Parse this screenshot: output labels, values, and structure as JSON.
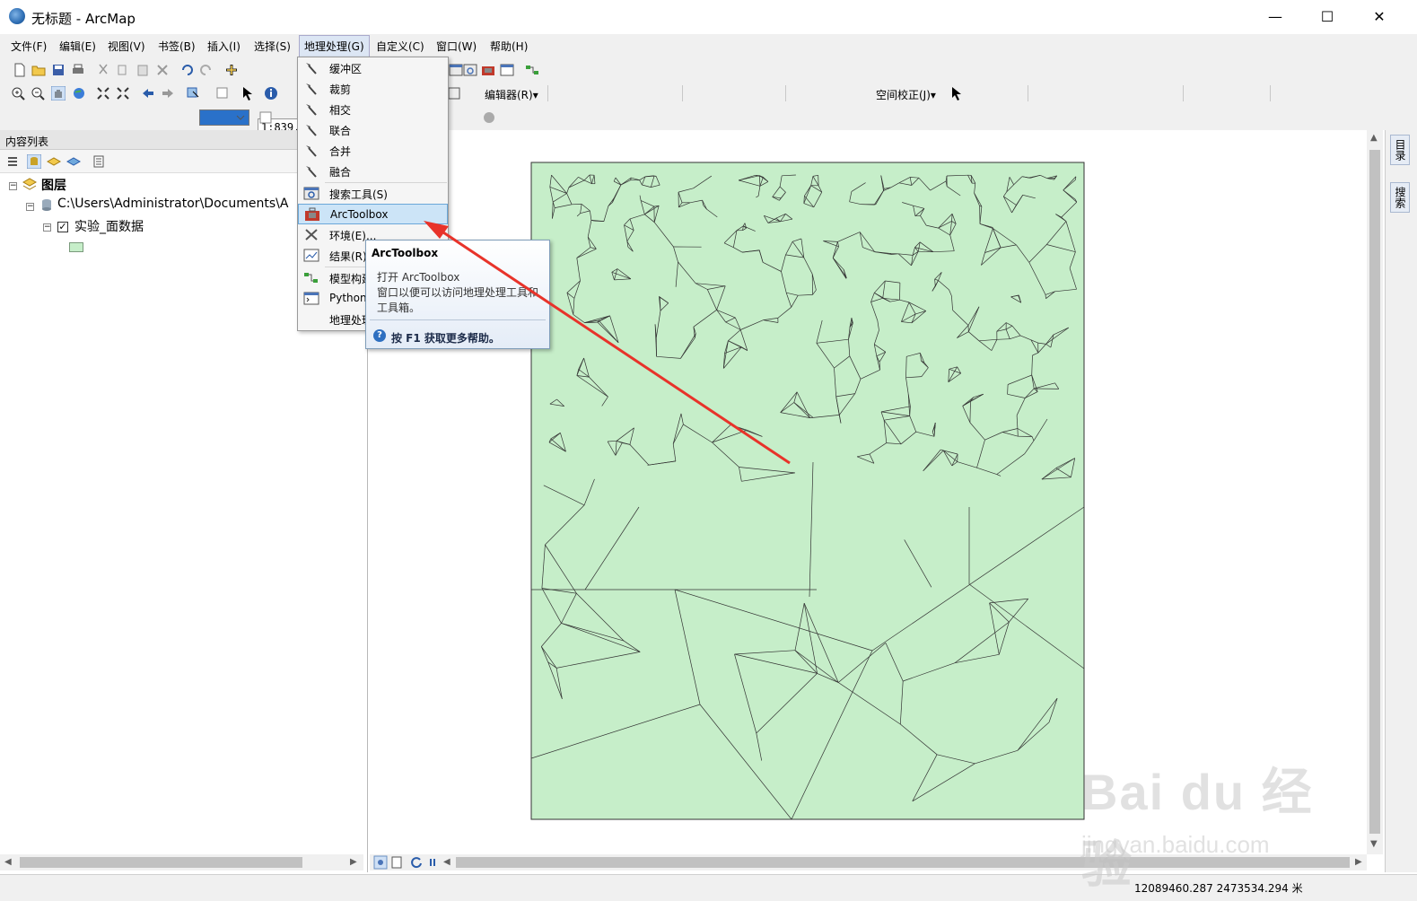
{
  "window": {
    "title": "无标题 - ArcMap",
    "minimize": "—",
    "maximize": "☐",
    "close": "✕"
  },
  "menubar": {
    "items": [
      "文件(F)",
      "编辑(E)",
      "视图(V)",
      "书签(B)",
      "插入(I)",
      "选择(S)",
      "地理处理(G)",
      "自定义(C)",
      "窗口(W)",
      "帮助(H)"
    ],
    "active_index": 6
  },
  "toolbar": {
    "scale_value": "1:839,",
    "editor_label": "编辑器(R)▾",
    "spatial_adjust_label": "空间校正(J)▾"
  },
  "toc": {
    "header": "内容列表",
    "layers_root": "图层",
    "data_path": "C:\\Users\\Administrator\\Documents\\A",
    "layer_name": "实验_面数据",
    "layer_color": "#c6eec9"
  },
  "geoprocessing_menu": {
    "items": [
      {
        "label": "缓冲区",
        "icon": "hammer-icon"
      },
      {
        "label": "裁剪",
        "icon": "hammer-icon"
      },
      {
        "label": "相交",
        "icon": "hammer-icon"
      },
      {
        "label": "联合",
        "icon": "hammer-icon"
      },
      {
        "label": "合并",
        "icon": "hammer-icon"
      },
      {
        "label": "融合",
        "icon": "hammer-icon"
      },
      {
        "label": "搜索工具(S)",
        "icon": "search-window-icon"
      },
      {
        "label": "ArcToolbox",
        "icon": "toolbox-icon"
      },
      {
        "label": "环境(E)...",
        "icon": "tools-icon"
      },
      {
        "label": "结果(R)",
        "icon": "results-icon"
      },
      {
        "label": "模型构建",
        "icon": "model-builder-icon"
      },
      {
        "label": "Python",
        "icon": "python-window-icon"
      },
      {
        "label": "地理处理",
        "icon": ""
      }
    ],
    "highlight_index": 7
  },
  "tooltip": {
    "title": "ArcToolbox",
    "line1": "打开 ArcToolbox",
    "line2": "窗口以便可以访问地理处理工具和",
    "line3": "工具箱。",
    "help": "按 F1 获取更多帮助。"
  },
  "right_dock": {
    "tab1": "目录",
    "tab2": "搜索"
  },
  "statusbar": {
    "coordinates": "12089460.287  2473534.294 米"
  },
  "colors": {
    "polygon_fill": "#c6eec9",
    "polygon_stroke": "#333333",
    "annotation_arrow": "#e8332a",
    "menu_highlight": "#cce4f7"
  },
  "watermark": {
    "brand": "Bai du 经验",
    "url": "jingyan.baidu.com"
  }
}
